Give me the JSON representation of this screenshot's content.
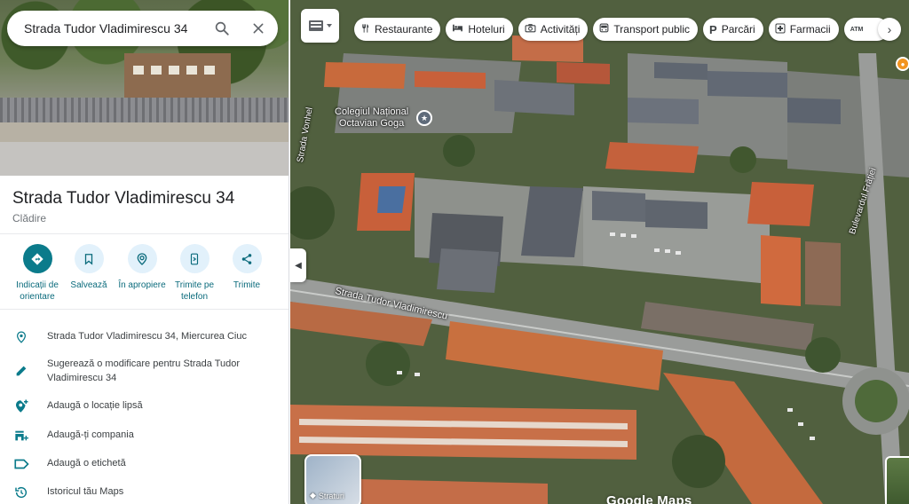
{
  "search": {
    "value": "Strada Tudor Vladimirescu 34"
  },
  "place": {
    "title": "Strada Tudor Vladimirescu 34",
    "category": "Clădire"
  },
  "actions": [
    {
      "label": "Indicații de orientare"
    },
    {
      "label": "Salvează"
    },
    {
      "label": "În apropiere"
    },
    {
      "label": "Trimite pe telefon"
    },
    {
      "label": "Trimite"
    }
  ],
  "info": [
    {
      "icon": "location-pin-icon",
      "text": "Strada Tudor Vladimirescu 34, Miercurea Ciuc"
    },
    {
      "icon": "pencil-icon",
      "text": "Sugerează o modificare pentru Strada Tudor Vladimirescu 34"
    },
    {
      "icon": "add-location-icon",
      "text": "Adaugă o locație lipsă"
    },
    {
      "icon": "add-business-icon",
      "text": "Adaugă-ți compania"
    },
    {
      "icon": "label-icon",
      "text": "Adaugă o etichetă"
    },
    {
      "icon": "history-icon",
      "text": "Istoricul tău Maps"
    }
  ],
  "chips": [
    {
      "icon": "restaurant-icon",
      "label": "Restaurante"
    },
    {
      "icon": "hotel-icon",
      "label": "Hoteluri"
    },
    {
      "icon": "camera-icon",
      "label": "Activități"
    },
    {
      "icon": "bus-icon",
      "label": "Transport public"
    },
    {
      "icon": "parking-icon",
      "label": "Parcări"
    },
    {
      "icon": "pharmacy-icon",
      "label": "Farmacii"
    },
    {
      "icon": "atm-icon",
      "label": "ATM"
    }
  ],
  "map": {
    "labels": {
      "street": "Strada Tudor Vladimirescu",
      "school_line1": "Colegiul Național",
      "school_line2": "Octavian Goga",
      "boulevard": "Bulevardul Frăției",
      "street_vertical": "Strada Vonhel"
    },
    "layers_label": "Straturi",
    "watermark": "Google Maps"
  },
  "colors": {
    "accent": "#0b7b8b",
    "action_bg": "#e2f1fb",
    "roof": "#c8603a"
  }
}
